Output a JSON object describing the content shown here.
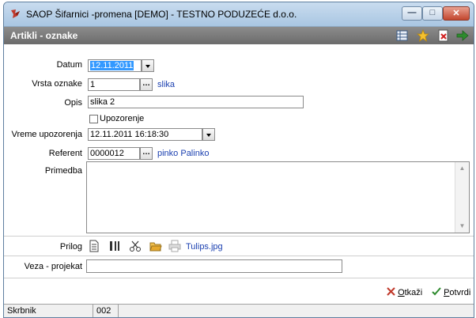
{
  "window": {
    "title": "SAOP Šifarnici -promena [DEMO] - TESTNO PODUZEĆE d.o.o.",
    "controls": [
      "minimize",
      "maximize",
      "close"
    ]
  },
  "form": {
    "title": "Artikli - oznake",
    "toolbar_icons": [
      "grid-icon",
      "star-icon",
      "document-x-icon",
      "exit-arrow-icon"
    ]
  },
  "fields": {
    "datum": {
      "label": "Datum",
      "value": "12.11.2011"
    },
    "vrsta_oznake": {
      "label": "Vrsta oznake",
      "value": "1",
      "link": "slika"
    },
    "opis": {
      "label": "Opis",
      "value": "slika 2"
    },
    "upozorenje": {
      "label": "Upozorenje",
      "checked": false
    },
    "vreme_upozorenja": {
      "label": "Vreme upozorenja",
      "value": "12.11.2011 16:18:30"
    },
    "referent": {
      "label": "Referent",
      "value": "0000012",
      "link": "pinko Palinko"
    },
    "primedba": {
      "label": "Primedba",
      "value": ""
    },
    "prilog": {
      "label": "Prilog",
      "file": "Tulips.jpg"
    },
    "veza_projekat": {
      "label": "Veza - projekat",
      "value": ""
    }
  },
  "buttons": {
    "otkazi": {
      "label_u": "O",
      "label_rest": "tkaži"
    },
    "potvrdi": {
      "label_u": "P",
      "label_rest": "otvrdi"
    }
  },
  "statusbar": {
    "user": "Skrbnik",
    "code": "002"
  }
}
